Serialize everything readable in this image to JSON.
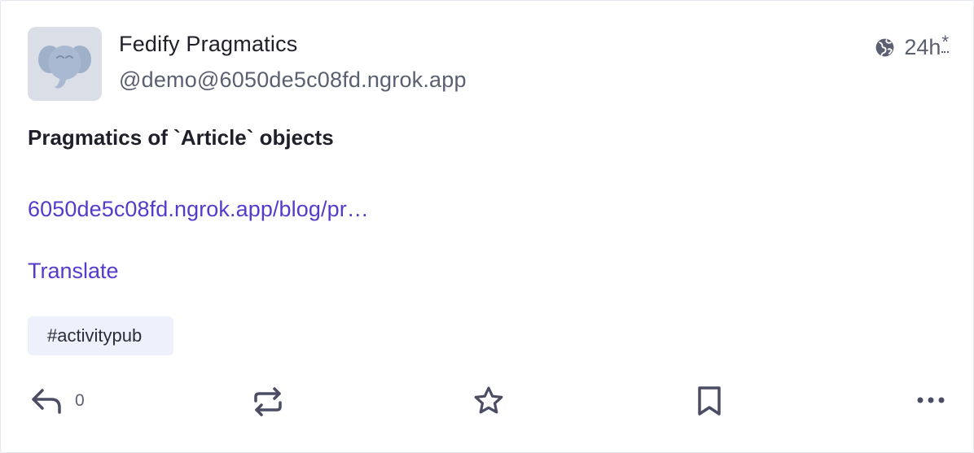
{
  "post": {
    "display_name": "Fedify Pragmatics",
    "handle": "@demo@6050de5c08fd.ngrok.app",
    "visibility_icon": "globe-icon",
    "time": "24h",
    "edited_marker": "*",
    "title": "Pragmatics of `Article` objects",
    "link_text": "6050de5c08fd.ngrok.app/blog/pr…",
    "translate_label": "Translate",
    "hashtag": "#activitypub"
  },
  "actions": {
    "reply_count": "0",
    "icons": [
      "reply-icon",
      "boost-icon",
      "star-icon",
      "bookmark-icon",
      "more-icon"
    ]
  },
  "colors": {
    "accent": "#563acc",
    "text": "#1f1f2a",
    "muted": "#5b5f72",
    "tag_bg": "#eef0fb",
    "avatar_bg": "#d9dee7"
  }
}
